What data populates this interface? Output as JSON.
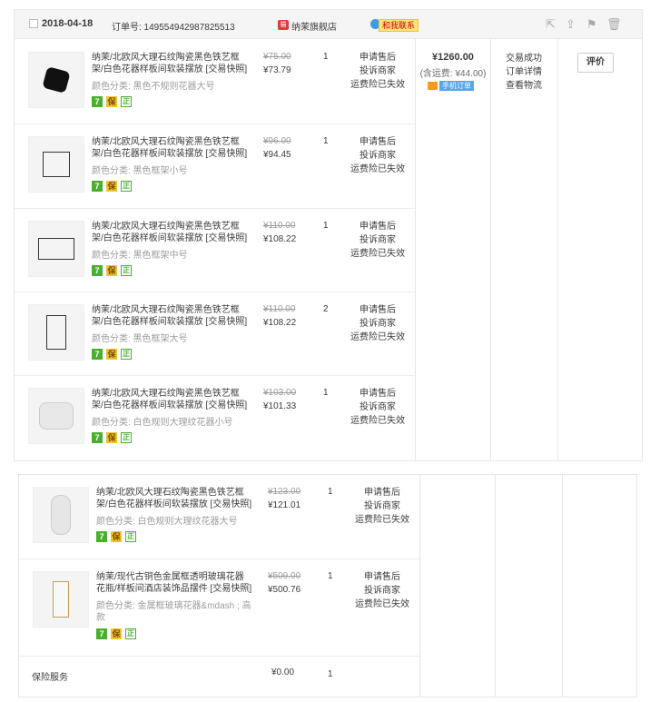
{
  "order": {
    "date": "2018-04-18",
    "order_no": "订单号: 149554942987825513",
    "shop_badge": "猫",
    "shop": "纳茉旗舰店",
    "contact": "和我联系",
    "total": "¥1260.00",
    "shipping": "(含运费: ¥44.00)",
    "mobile_order": "手机订单",
    "status": [
      "交易成功",
      "订单详情",
      "查看物流"
    ],
    "review": "评价"
  },
  "items": [
    {
      "title": "纳茉/北欧风大理石纹陶瓷黑色铁艺框架/白色花器样板间软装摆放 [交易快照]",
      "sku": "颜色分类: 黑色不规则花器大号",
      "old": "¥75.00",
      "price": "¥73.79",
      "qty": "1"
    },
    {
      "title": "纳茉/北欧风大理石纹陶瓷黑色铁艺框架/白色花器样板间软装摆放 [交易快照]",
      "sku": "颜色分类: 黑色框架小号",
      "old": "¥96.00",
      "price": "¥94.45",
      "qty": "1"
    },
    {
      "title": "纳茉/北欧风大理石纹陶瓷黑色铁艺框架/白色花器样板间软装摆放 [交易快照]",
      "sku": "颜色分类: 黑色框架中号",
      "old": "¥110.00",
      "price": "¥108.22",
      "qty": "1"
    },
    {
      "title": "纳茉/北欧风大理石纹陶瓷黑色铁艺框架/白色花器样板间软装摆放 [交易快照]",
      "sku": "颜色分类: 黑色框架大号",
      "old": "¥110.00",
      "price": "¥108.22",
      "qty": "2"
    },
    {
      "title": "纳茉/北欧风大理石纹陶瓷黑色铁艺框架/白色花器样板间软装摆放 [交易快照]",
      "sku": "颜色分类: 白色规则大理纹花器小号",
      "old": "¥103.00",
      "price": "¥101.33",
      "qty": "1"
    },
    {
      "title": "纳茉/北欧风大理石纹陶瓷黑色铁艺框架/白色花器样板间软装摆放 [交易快照]",
      "sku": "颜色分类: 白色规则大理纹花器大号",
      "old": "¥123.00",
      "price": "¥121.01",
      "qty": "1"
    },
    {
      "title": "纳茉/现代古铜色金属框透明玻璃花器花瓶/样板间酒店装饰品摆件 [交易快照]",
      "sku": "颜色分类: 金属框玻璃花器&mdash ; 高款",
      "old": "¥509.00",
      "price": "¥500.76",
      "qty": "1"
    }
  ],
  "item_ops": [
    "申请售后",
    "投诉商家",
    "运费险已失效"
  ],
  "tags": [
    "7",
    "保",
    "正"
  ],
  "insurance": {
    "label": "保险服务",
    "price": "¥0.00",
    "qty": "1"
  },
  "colors": {
    "tag_green": "#4aaf2e",
    "tag_gold": "#f0c330",
    "brand_red": "#e4393c"
  }
}
